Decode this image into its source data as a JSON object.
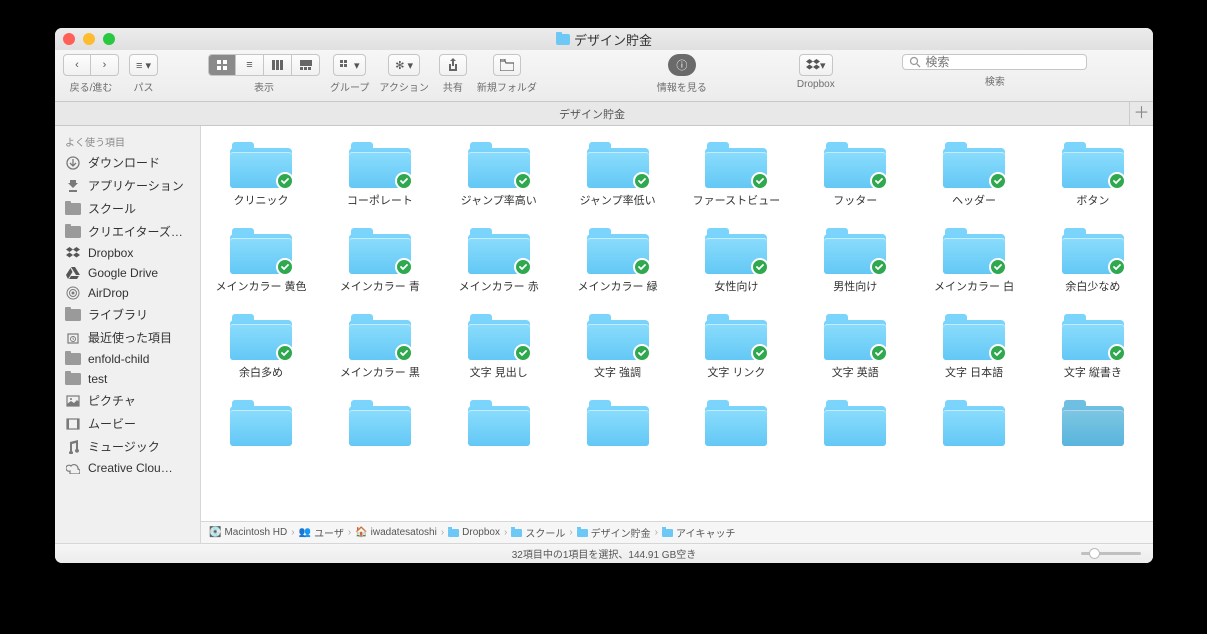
{
  "window": {
    "title": "デザイン貯金"
  },
  "toolbar": {
    "back": "戻る/進む",
    "path": "パス",
    "view": "表示",
    "group": "グループ",
    "action": "アクション",
    "share": "共有",
    "newfolder": "新規フォルダ",
    "info": "情報を見る",
    "dropbox": "Dropbox",
    "search": "検索",
    "search_placeholder": "検索"
  },
  "tab": {
    "name": "デザイン貯金"
  },
  "sidebar": {
    "header": "よく使う項目",
    "items": [
      {
        "label": "ダウンロード",
        "icon": "download"
      },
      {
        "label": "アプリケーション",
        "icon": "app"
      },
      {
        "label": "スクール",
        "icon": "folder"
      },
      {
        "label": "クリエイターズ…",
        "icon": "folder"
      },
      {
        "label": "Dropbox",
        "icon": "dropbox"
      },
      {
        "label": "Google Drive",
        "icon": "gdrive"
      },
      {
        "label": "AirDrop",
        "icon": "airdrop"
      },
      {
        "label": "ライブラリ",
        "icon": "folder"
      },
      {
        "label": "最近使った項目",
        "icon": "recent"
      },
      {
        "label": "enfold-child",
        "icon": "folder"
      },
      {
        "label": "test",
        "icon": "folder"
      },
      {
        "label": "ピクチャ",
        "icon": "pictures"
      },
      {
        "label": "ムービー",
        "icon": "movies"
      },
      {
        "label": "ミュージック",
        "icon": "music"
      },
      {
        "label": "Creative Clou…",
        "icon": "cc"
      }
    ]
  },
  "folders": [
    [
      "クリニック",
      "コーポレート",
      "ジャンプ率高い",
      "ジャンプ率低い",
      "ファーストビュー",
      "フッター",
      "ヘッダー",
      "ボタン"
    ],
    [
      "メインカラー 黄色",
      "メインカラー 青",
      "メインカラー 赤",
      "メインカラー 緑",
      "女性向け",
      "男性向け",
      "メインカラー 白",
      "余白少なめ"
    ],
    [
      "余白多め",
      "メインカラー 黒",
      "文字 見出し",
      "文字 強調",
      "文字 リンク",
      "文字 英語",
      "文字 日本語",
      "文字 縦書き"
    ]
  ],
  "pathbar": [
    "Macintosh HD",
    "ユーザ",
    "iwadatesatoshi",
    "Dropbox",
    "スクール",
    "デザイン貯金",
    "アイキャッチ"
  ],
  "status": "32項目中の1項目を選択、144.91 GB空き"
}
